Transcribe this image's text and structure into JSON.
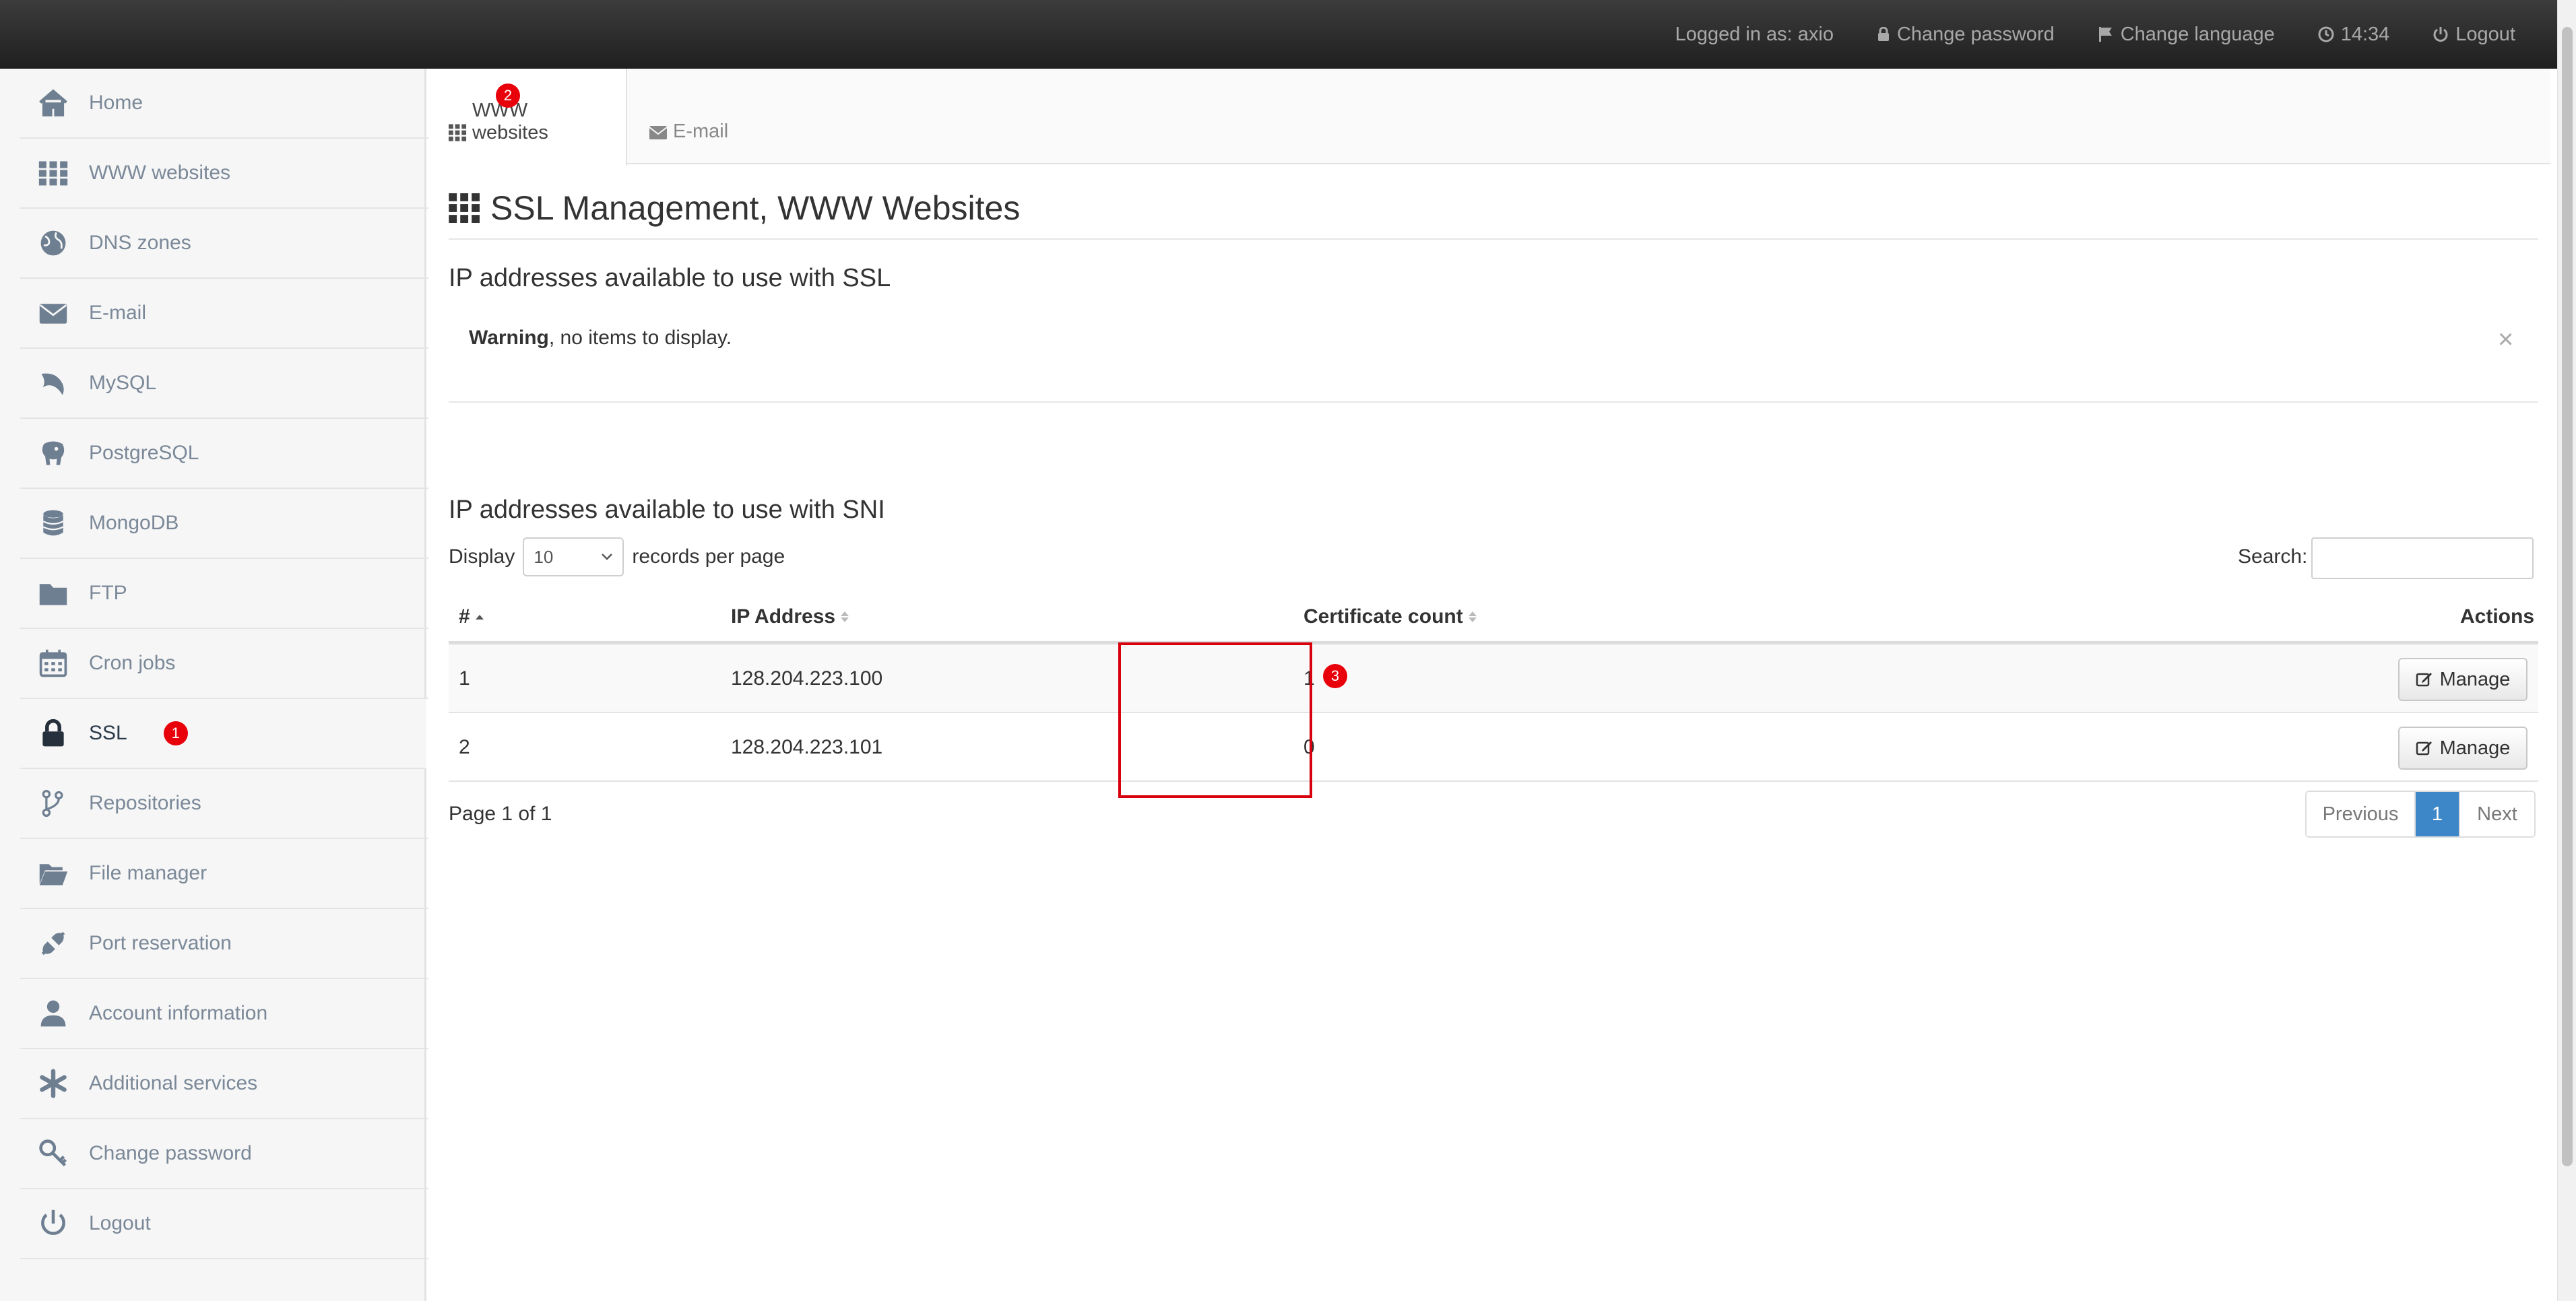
{
  "topbar": {
    "logged_in": "Logged in as: axio",
    "change_password": "Change password",
    "change_language": "Change language",
    "time": "14:34",
    "logout": "Logout"
  },
  "sidebar": {
    "items": [
      {
        "label": "Home",
        "icon": "home-icon"
      },
      {
        "label": "WWW websites",
        "icon": "grid-icon"
      },
      {
        "label": "DNS zones",
        "icon": "globe-icon"
      },
      {
        "label": "E-mail",
        "icon": "envelope-icon"
      },
      {
        "label": "MySQL",
        "icon": "dolphin-icon"
      },
      {
        "label": "PostgreSQL",
        "icon": "elephant-icon"
      },
      {
        "label": "MongoDB",
        "icon": "database-icon"
      },
      {
        "label": "FTP",
        "icon": "folder-icon"
      },
      {
        "label": "Cron jobs",
        "icon": "calendar-icon"
      },
      {
        "label": "SSL",
        "icon": "lock-icon",
        "badge": "1"
      },
      {
        "label": "Repositories",
        "icon": "branch-icon"
      },
      {
        "label": "File manager",
        "icon": "folder-open-icon"
      },
      {
        "label": "Port reservation",
        "icon": "plug-icon"
      },
      {
        "label": "Account information",
        "icon": "user-icon"
      },
      {
        "label": "Additional services",
        "icon": "asterisk-icon"
      },
      {
        "label": "Change password",
        "icon": "key-icon"
      },
      {
        "label": "Logout",
        "icon": "power-icon"
      }
    ]
  },
  "tabs": [
    {
      "label": "WWW websites",
      "badge": "2"
    },
    {
      "label": "E-mail"
    }
  ],
  "page_title": "SSL Management, WWW Websites",
  "ssl_section": {
    "title": "IP addresses available to use with SSL",
    "warning_strong": "Warning",
    "warning_text": ", no items to display.",
    "close": "×"
  },
  "sni_section": {
    "title": "IP addresses available to use with SNI",
    "display_label": "Display",
    "per_page_value": "10",
    "records_label": "records per page",
    "search_label": "Search:",
    "columns": {
      "num": "#",
      "ip": "IP Address",
      "cert": "Certificate count",
      "actions": "Actions"
    },
    "rows": [
      {
        "num": "1",
        "ip": "128.204.223.100",
        "cert": "1",
        "action": "Manage"
      },
      {
        "num": "2",
        "ip": "128.204.223.101",
        "cert": "0",
        "action": "Manage"
      }
    ],
    "highlight_badge": "3",
    "page_info": "Page 1 of 1",
    "pagination": {
      "previous": "Previous",
      "current": "1",
      "next": "Next"
    }
  }
}
